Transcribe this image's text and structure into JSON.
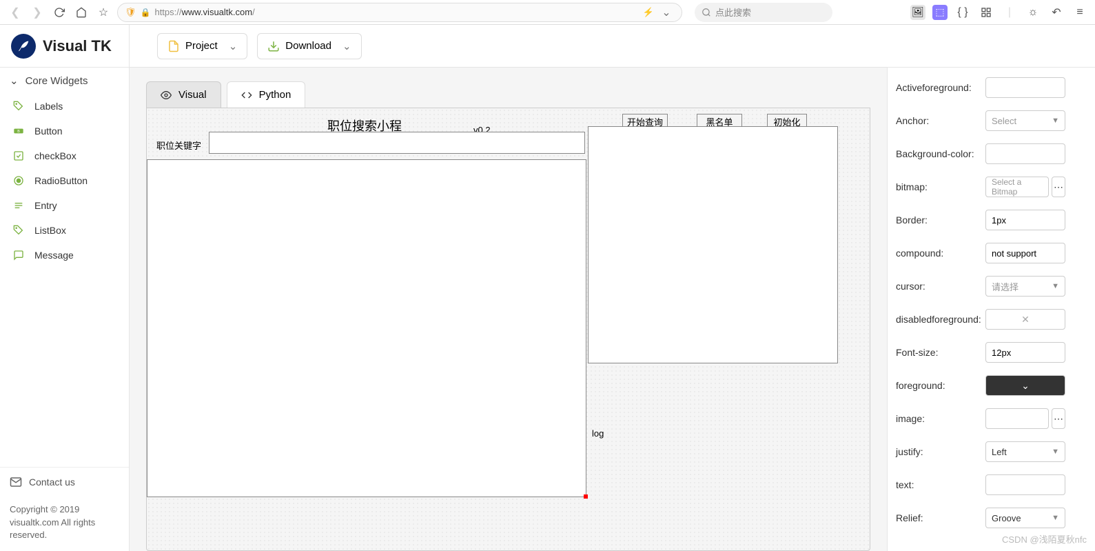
{
  "browser": {
    "url_prefix": "https://",
    "url_host": "www.visualtk.com",
    "url_path": "/",
    "search_placeholder": "点此搜索"
  },
  "app": {
    "name": "Visual TK"
  },
  "toolbar": {
    "project": "Project",
    "download": "Download"
  },
  "sidebar": {
    "header": "Core Widgets",
    "items": [
      "Labels",
      "Button",
      "checkBox",
      "RadioButton",
      "Entry",
      "ListBox",
      "Message"
    ],
    "contact": "Contact us",
    "copyright": "Copyright © 2019 visualtk.com All rights reserved."
  },
  "tabs": {
    "visual": "Visual",
    "python": "Python"
  },
  "canvas": {
    "title": "职位搜索小程序",
    "version": "v0.2",
    "btn_start": "开始查询",
    "btn_blacklist": "黑名单",
    "btn_init": "初始化",
    "lbl_keyword": "职位关键字",
    "lbl_log": "log"
  },
  "props": {
    "activeforeground": {
      "label": "Activeforeground:",
      "value": ""
    },
    "anchor": {
      "label": "Anchor:",
      "value": "Select"
    },
    "background": {
      "label": "Background-color:",
      "value": ""
    },
    "bitmap": {
      "label": "bitmap:",
      "value": "Select a Bitmap"
    },
    "border": {
      "label": "Border:",
      "value": "1px"
    },
    "compound": {
      "label": "compound:",
      "value": "not support"
    },
    "cursor": {
      "label": "cursor:",
      "value": "请选择"
    },
    "disabledforeground": {
      "label": "disabledforeground:",
      "value": ""
    },
    "fontsize": {
      "label": "Font-size:",
      "value": "12px"
    },
    "foreground": {
      "label": "foreground:",
      "value": "#333333"
    },
    "image": {
      "label": "image:",
      "value": ""
    },
    "justify": {
      "label": "justify:",
      "value": "Left"
    },
    "text": {
      "label": "text:",
      "value": ""
    },
    "relief": {
      "label": "Relief:",
      "value": "Groove"
    }
  },
  "watermark": "CSDN @浅陌夏秋nfc"
}
